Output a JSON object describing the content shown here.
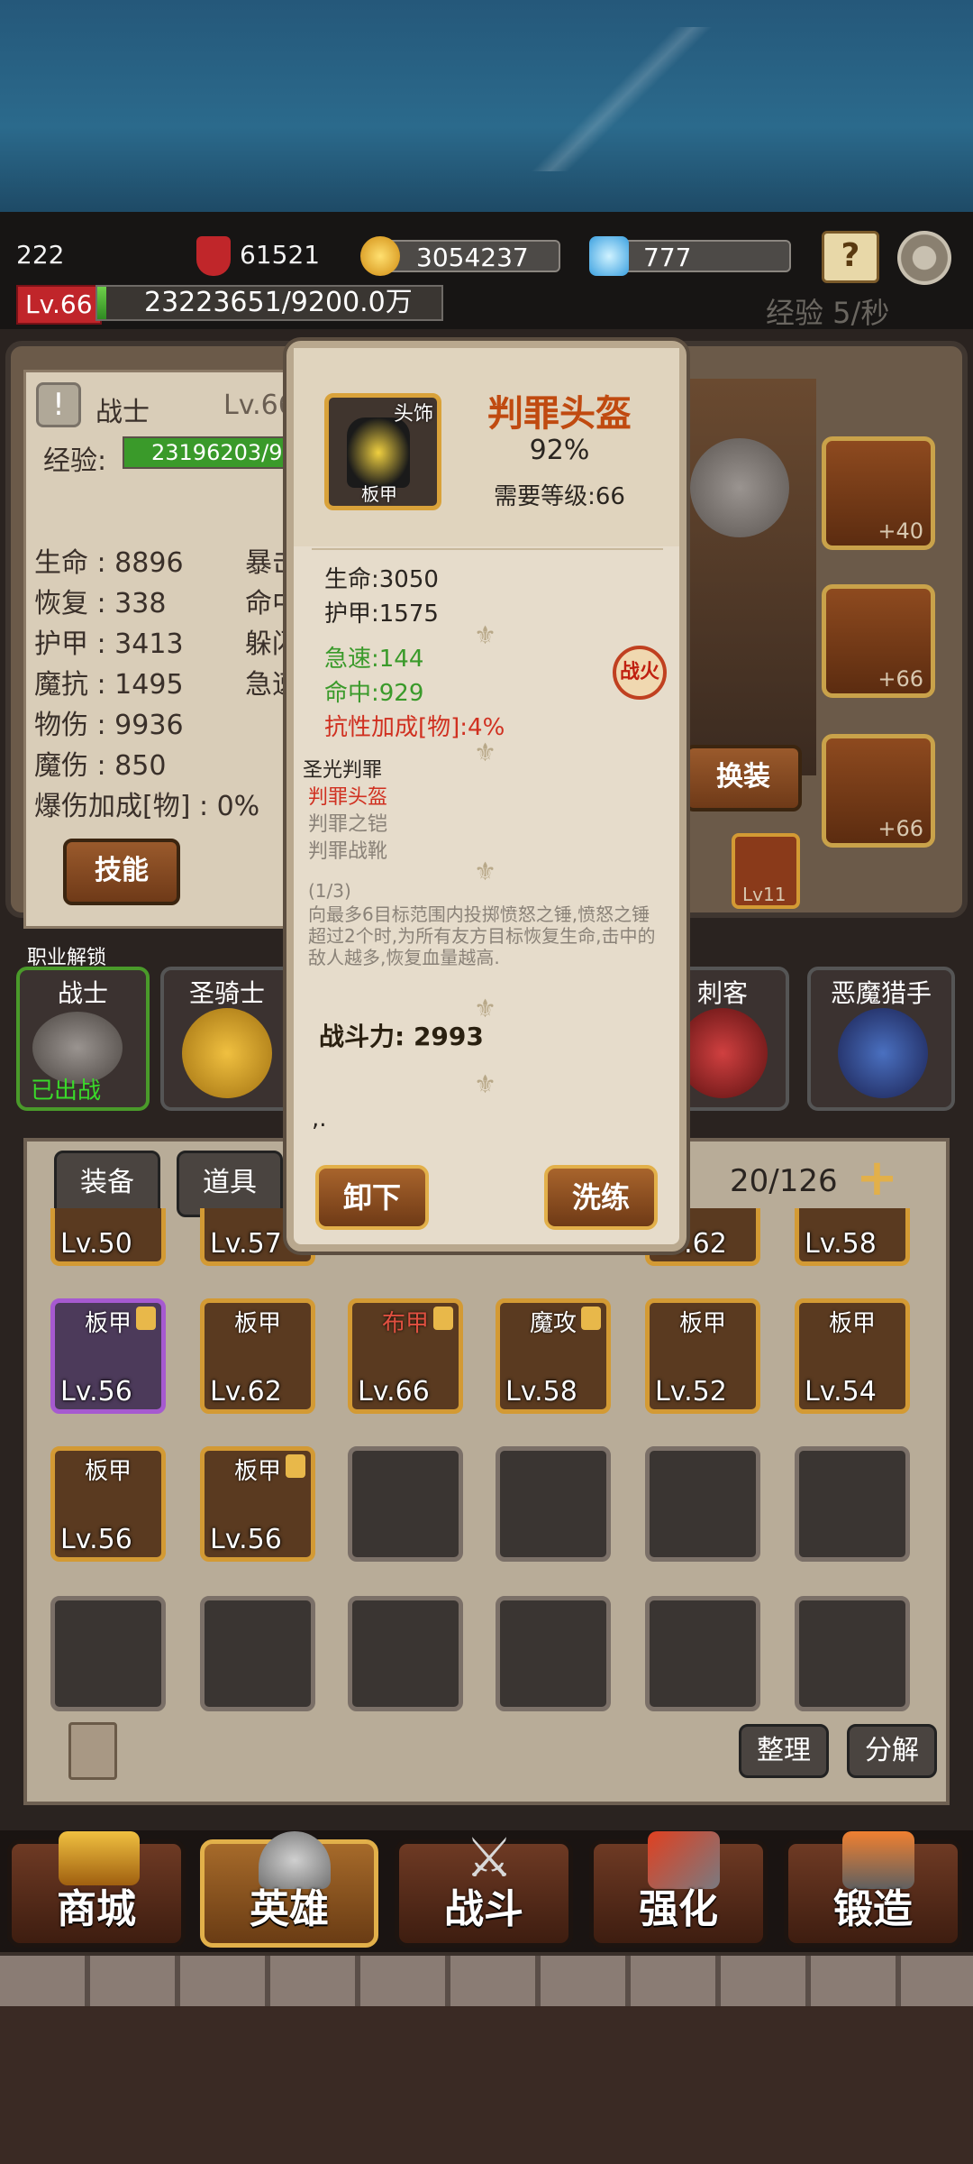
{
  "topbar": {
    "player_id": "222",
    "power": "61521",
    "gold": "3054237",
    "gems": "777",
    "level": "Lv.66",
    "xp_text": "23223651/9200.0万",
    "xp_fraction": 0.025,
    "exp_rate": "经验 5/秒"
  },
  "hero": {
    "class_name": "战士",
    "level": "Lv.66",
    "exp_label": "经验:",
    "exp_value": "23196203/9",
    "stats_left": [
      "生命 : 8896",
      "恢复 : 338",
      "护甲 : 3413",
      "魔抗 : 1495",
      "物伤 : 9936",
      "魔伤 : 850",
      "爆伤加成[物] : 0%"
    ],
    "stats_right": [
      "暴击",
      "命中",
      "躲闪",
      "急速"
    ],
    "skill_button": "技能",
    "change_button": "换装",
    "equip_levels": [
      "+40",
      "+66",
      "+66"
    ],
    "gem_level": "Lv11"
  },
  "unlock": {
    "label": "职业解锁",
    "heroes": [
      {
        "name": "战士",
        "status": "已出战"
      },
      {
        "name": "圣骑士",
        "status": ""
      },
      {
        "name": "刺客",
        "status": ""
      },
      {
        "name": "恶魔猎手",
        "status": ""
      }
    ]
  },
  "inventory": {
    "tab_equip": "装备",
    "tab_items": "道具",
    "capacity": "20/126",
    "row0": [
      "Lv.50",
      "Lv.57",
      "",
      "",
      "Lv.62",
      "Lv.58"
    ],
    "row1": [
      {
        "type": "板甲",
        "lv": "Lv.56",
        "locked": true,
        "color": "purple"
      },
      {
        "type": "板甲",
        "lv": "Lv.62",
        "locked": false,
        "color": "orange"
      },
      {
        "type": "布甲",
        "lv": "Lv.66",
        "locked": true,
        "color": "orange"
      },
      {
        "type": "魔攻",
        "lv": "Lv.58",
        "locked": true,
        "color": "orange"
      },
      {
        "type": "板甲",
        "lv": "Lv.52",
        "locked": false,
        "color": "orange"
      },
      {
        "type": "板甲",
        "lv": "Lv.54",
        "locked": false,
        "color": "orange"
      }
    ],
    "row2": [
      {
        "type": "板甲",
        "lv": "Lv.56",
        "locked": false,
        "color": "orange"
      },
      {
        "type": "板甲",
        "lv": "Lv.56",
        "locked": true,
        "color": "orange"
      }
    ],
    "sort_button": "整理",
    "decompose_button": "分解"
  },
  "nav": [
    "商城",
    "英雄",
    "战斗",
    "强化",
    "锻造"
  ],
  "item_modal": {
    "slot": "头饰",
    "armor_type": "板甲",
    "name": "判罪头盔",
    "percent": "92%",
    "required_level": "需要等级:66",
    "base_stats": [
      "生命:3050",
      "护甲:1575"
    ],
    "green_stats": [
      "急速:144",
      "命中:929"
    ],
    "red_stat": "抗性加成[物]:4%",
    "badge": "战火",
    "set_name": "圣光判罪",
    "set_items": [
      "判罪头盔",
      "判罪之铠",
      "判罪战靴"
    ],
    "set_count": "(1/3)",
    "set_desc": "向最多6目标范围内投掷愤怒之锤,愤怒之锤超过2个时,为所有友方目标恢复生命,击中的敌人越多,恢复血量越高.",
    "power": "战斗力: 2993",
    "note": ",.",
    "unequip_button": "卸下",
    "reforge_button": "洗练"
  },
  "colors": {
    "accent_gold": "#e2b04a",
    "title_red": "#c04a10",
    "green_stat": "#3a9a2a",
    "red_stat": "#d03020"
  }
}
